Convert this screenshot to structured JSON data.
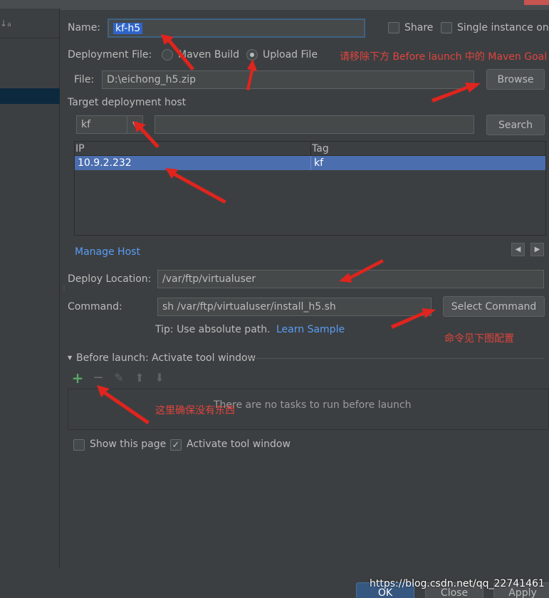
{
  "sort_icon_text": "↓a\nz",
  "name": {
    "label": "Name:",
    "value": "kf-h5"
  },
  "share": {
    "label": "Share",
    "checked": false
  },
  "single_instance": {
    "label": "Single instance onl",
    "checked": false
  },
  "deployment_file": {
    "label": "Deployment File:",
    "options": [
      "Maven Build",
      "Upload File"
    ],
    "selected": "Upload File"
  },
  "annotations": {
    "note_top": "请移除下方 Before launch 中的 Maven Goal",
    "note_command": "命令见下图配置",
    "note_tasks": "这里确保没有东西"
  },
  "file": {
    "label": "File:",
    "value": "D:\\eichong_h5.zip",
    "browse_label": "Browse"
  },
  "target_host": {
    "heading": "Target deployment host",
    "dropdown_value": "kf",
    "search_value": "",
    "search_label": "Search",
    "columns": [
      "IP",
      "Tag"
    ],
    "rows": [
      {
        "ip": "10.9.2.232",
        "tag": "kf"
      }
    ],
    "manage_host_label": "Manage Host",
    "prev_icon": "◀",
    "next_icon": "▶"
  },
  "deploy_location": {
    "label": "Deploy Location:",
    "value": "/var/ftp/virtualuser"
  },
  "command": {
    "label": "Command:",
    "value": "sh /var/ftp/virtualuser/install_h5.sh",
    "select_label": "Select Command",
    "tip": "Tip: Use absolute path.",
    "learn_sample": "Learn Sample"
  },
  "before_launch": {
    "heading": "Before launch: Activate tool window",
    "toolbar_icons": [
      "+",
      "−",
      "✎",
      "⬆",
      "⬇"
    ],
    "empty_text": "There are no tasks to run before launch"
  },
  "show_this_page": {
    "label": "Show this page",
    "checked": false
  },
  "activate_tool_window": {
    "label": "Activate tool window",
    "checked": true,
    "check_glyph": "✓"
  },
  "buttons": {
    "ok": "OK",
    "close": "Close",
    "apply": "Apply"
  },
  "watermark": "https://blog.csdn.net/qq_22741461",
  "colors": {
    "background": "#3c3f41",
    "selection": "#4b6eaf",
    "link": "#589df6",
    "annotation": "#e0443e",
    "add_icon": "#59a869"
  }
}
